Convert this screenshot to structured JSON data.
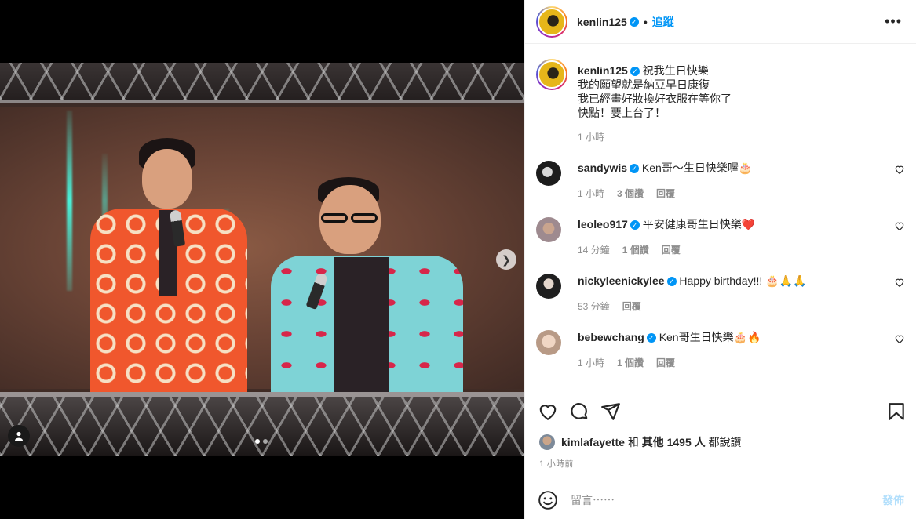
{
  "post": {
    "username": "kenlin125",
    "follow_label": "追蹤",
    "more_icon": "more-horizontal-icon",
    "caption": {
      "username": "kenlin125",
      "lines": [
        "祝我生日快樂",
        "我的願望就是納豆早日康復",
        "我已經畫好妝換好衣服在等你了",
        "快點！要上台了！"
      ],
      "time": "1 小時"
    }
  },
  "comments": [
    {
      "username": "sandywis",
      "text": "Ken哥～生日快樂喔🎂",
      "time": "1 小時",
      "likes": "3 個讚",
      "reply": "回覆",
      "avatar_color": "#3a3a3a"
    },
    {
      "username": "leoleo917",
      "text": "平安健康哥生日快樂❤️",
      "time": "14 分鐘",
      "likes": "1 個讚",
      "reply": "回覆",
      "avatar_color": "#b58f8f"
    },
    {
      "username": "nickyleenickylee",
      "text": "Happy birthday!!! 🎂🙏🙏",
      "time": "53 分鐘",
      "likes": "",
      "reply": "回覆",
      "avatar_color": "#2b2b2b"
    },
    {
      "username": "bebewchang",
      "text": "Ken哥生日快樂🎂🔥",
      "time": "1 小時",
      "likes": "1 個讚",
      "reply": "回覆",
      "avatar_color": "#d9b9a6"
    }
  ],
  "likes_line": {
    "user": "kimlafayette",
    "connector": "和",
    "rest": "其他 1495 人",
    "suffix": "都說讚"
  },
  "posted_time": "1 小時前",
  "composer": {
    "placeholder": "留言⋯⋯",
    "post_label": "發佈"
  },
  "carousel": {
    "total": 2,
    "current": 1
  },
  "colors": {
    "accent": "#0095f6",
    "post_disabled": "#b2dffc"
  }
}
